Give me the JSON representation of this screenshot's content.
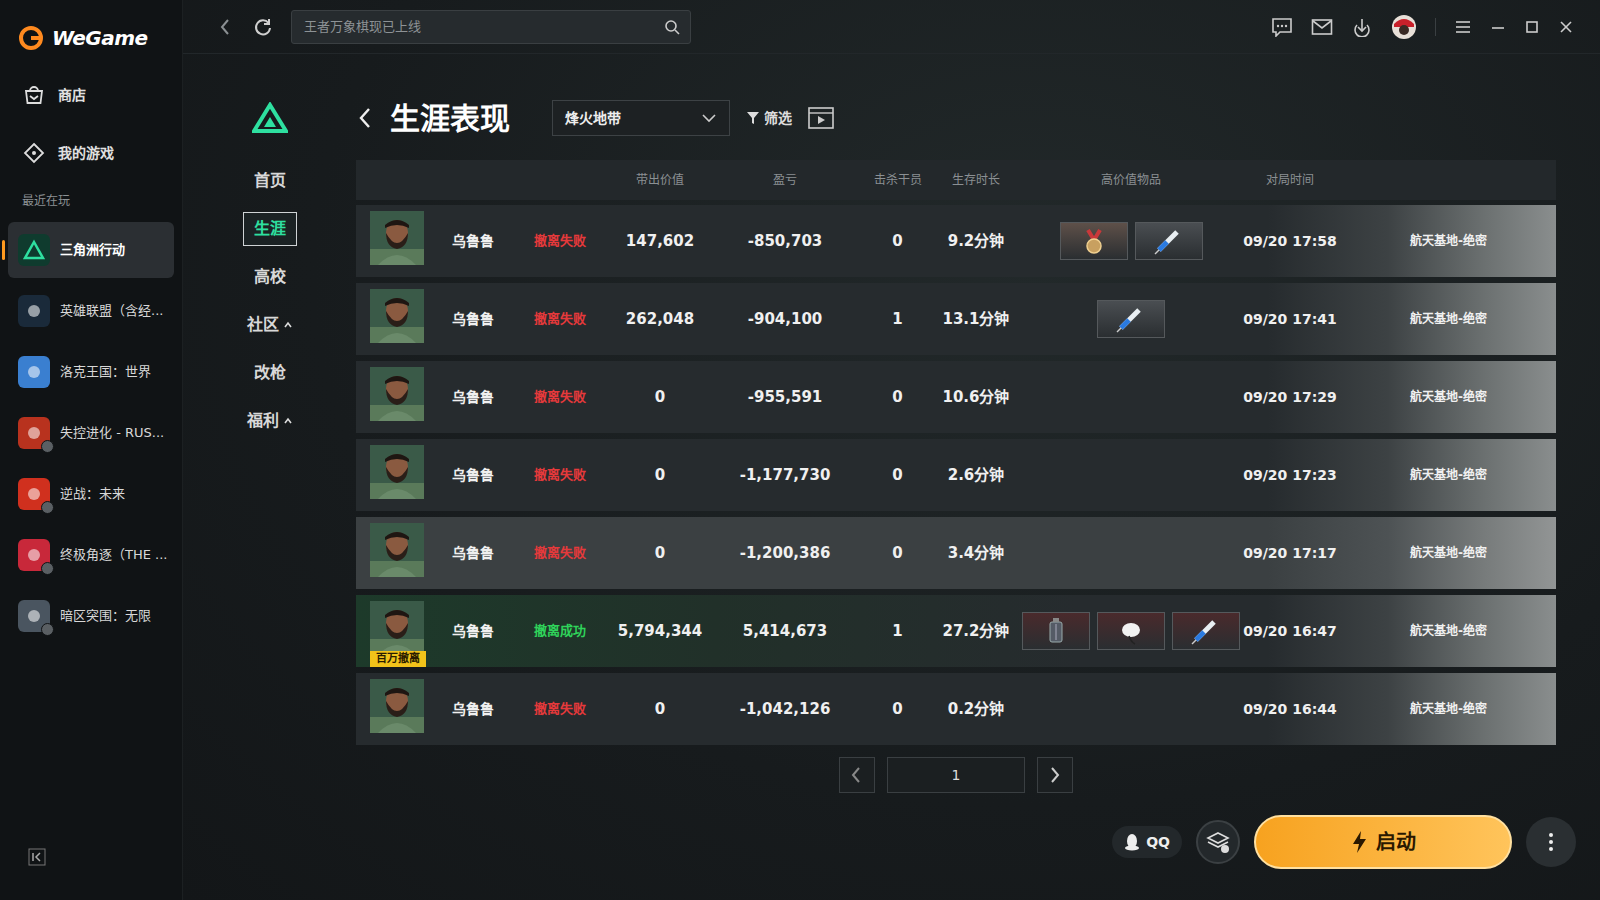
{
  "app": {
    "logo": "WeGame"
  },
  "sidebar": {
    "items": [
      {
        "label": "商店",
        "selected": false
      },
      {
        "label": "我的游戏",
        "selected": false
      }
    ],
    "recent_label": "最近在玩",
    "games": [
      {
        "label": "三角洲行动",
        "selected": true,
        "needs_download": false,
        "color": "#0f3b2e"
      },
      {
        "label": "英雄联盟（含经...",
        "selected": false,
        "needs_download": false,
        "color": "#1a2a3a"
      },
      {
        "label": "洛克王国：世界",
        "selected": false,
        "needs_download": false,
        "color": "#3a7fd0"
      },
      {
        "label": "失控进化 - RUS...",
        "selected": false,
        "needs_download": true,
        "color": "#b8321e"
      },
      {
        "label": "逆战：未来",
        "selected": false,
        "needs_download": true,
        "color": "#d0301e"
      },
      {
        "label": "终极角逐（THE ...",
        "selected": false,
        "needs_download": true,
        "color": "#c8283a"
      },
      {
        "label": "暗区突围：无限",
        "selected": false,
        "needs_download": true,
        "color": "#4a5560"
      }
    ]
  },
  "topbar": {
    "search": {
      "placeholder": "王者万象棋现已上线"
    }
  },
  "game_nav": {
    "items": [
      {
        "label": "首页",
        "selected": false,
        "expandable": false
      },
      {
        "label": "生涯",
        "selected": true,
        "expandable": false
      },
      {
        "label": "高校",
        "selected": false,
        "expandable": false
      },
      {
        "label": "社区",
        "selected": false,
        "expandable": true
      },
      {
        "label": "改枪",
        "selected": false,
        "expandable": false
      },
      {
        "label": "福利",
        "selected": false,
        "expandable": true
      }
    ]
  },
  "header": {
    "title": "生涯表现",
    "mode": "烽火地带",
    "filter": "筛选"
  },
  "table": {
    "columns": [
      "带出价值",
      "盈亏",
      "击杀干员",
      "生存时长",
      "高价值物品",
      "对局时间"
    ],
    "rows": [
      {
        "name": "乌鲁鲁",
        "result": "撤离失败",
        "extracted": false,
        "highlighted": false,
        "value": "147,602",
        "profit": "-850,703",
        "kills": "0",
        "duration": "9.2分钟",
        "items": [
          {
            "kind": "medal",
            "color": "#5e5049"
          },
          {
            "kind": "syringe",
            "color": "#4a4e52"
          }
        ],
        "time": "09/20 17:58",
        "map": "航天基地-绝密"
      },
      {
        "name": "乌鲁鲁",
        "result": "撤离失败",
        "extracted": false,
        "highlighted": false,
        "value": "262,048",
        "profit": "-904,100",
        "kills": "1",
        "duration": "13.1分钟",
        "items": [
          {
            "kind": "syringe",
            "color": "#4a4e52"
          }
        ],
        "time": "09/20 17:41",
        "map": "航天基地-绝密"
      },
      {
        "name": "乌鲁鲁",
        "result": "撤离失败",
        "extracted": false,
        "highlighted": false,
        "value": "0",
        "profit": "-955,591",
        "kills": "0",
        "duration": "10.6分钟",
        "items": [],
        "time": "09/20 17:29",
        "map": "航天基地-绝密"
      },
      {
        "name": "乌鲁鲁",
        "result": "撤离失败",
        "extracted": false,
        "highlighted": false,
        "value": "0",
        "profit": "-1,177,730",
        "kills": "0",
        "duration": "2.6分钟",
        "items": [],
        "time": "09/20 17:23",
        "map": "航天基地-绝密"
      },
      {
        "name": "乌鲁鲁",
        "result": "撤离失败",
        "extracted": false,
        "highlighted": true,
        "value": "0",
        "profit": "-1,200,386",
        "kills": "0",
        "duration": "3.4分钟",
        "items": [],
        "time": "09/20 17:17",
        "map": "航天基地-绝密"
      },
      {
        "name": "乌鲁鲁",
        "result": "撤离成功",
        "extracted": true,
        "highlighted": false,
        "badge": "百万撤离",
        "value": "5,794,344",
        "profit": "5,414,673",
        "kills": "1",
        "duration": "27.2分钟",
        "items": [
          {
            "kind": "lantern",
            "color": "#4a2a2c"
          },
          {
            "kind": "egg",
            "color": "#4a2a2c"
          },
          {
            "kind": "syringe",
            "color": "#4a2a2c"
          }
        ],
        "time": "09/20 16:47",
        "map": "航天基地-绝密"
      },
      {
        "name": "乌鲁鲁",
        "result": "撤离失败",
        "extracted": false,
        "highlighted": false,
        "value": "0",
        "profit": "-1,042,126",
        "kills": "0",
        "duration": "0.2分钟",
        "items": [],
        "time": "09/20 16:44",
        "map": "航天基地-绝密"
      }
    ]
  },
  "pagination": {
    "page": "1"
  },
  "footer": {
    "qq": "QQ",
    "launch": "启动"
  }
}
